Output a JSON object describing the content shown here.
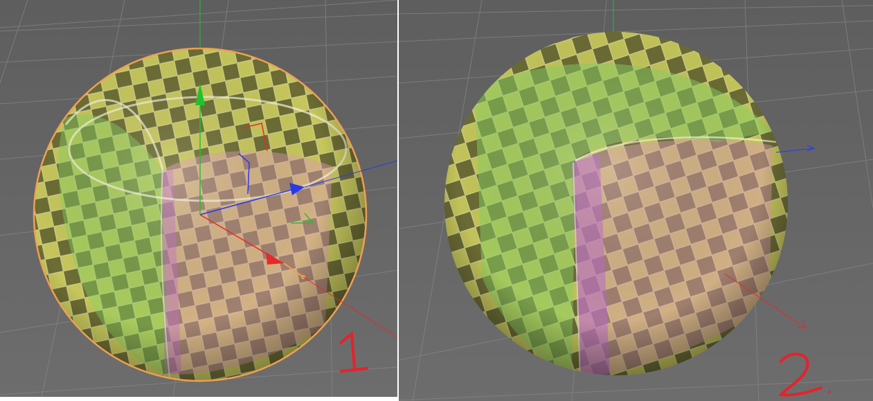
{
  "viewports": [
    {
      "label": "1",
      "annotation_color": "#e8212a",
      "selection_outline_color": "#f0a050"
    },
    {
      "label": "2",
      "annotation_color": "#e8212a"
    }
  ],
  "colors": {
    "viewport_bg": "#656565",
    "grid_line": "#8a8a8a",
    "axis_x": "#e52a2a",
    "axis_y": "#22c22a",
    "axis_z": "#2a3ae5",
    "checker_yellow": "#c9c95e",
    "checker_dark": "#6e6e35",
    "checker_green": "#7fc860",
    "checker_pink": "#d79bb0",
    "checker_purple": "#b36cc0"
  },
  "icons": [
    "move-gizmo-icon",
    "world-axis-icon"
  ]
}
